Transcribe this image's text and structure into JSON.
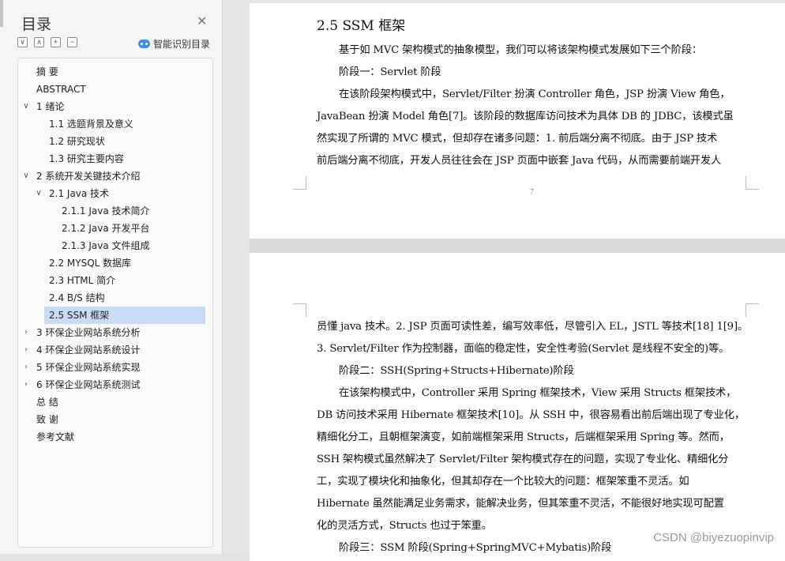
{
  "nav": {
    "title": "目录",
    "close_icon": "close-icon",
    "tools": [
      "collapse-all-icon",
      "collapse-level-icon",
      "expand-icon",
      "collapse-icon"
    ],
    "smart_toc_label": "智能识别目录",
    "items": [
      {
        "label": "摘    要",
        "level": 0,
        "caret": ""
      },
      {
        "label": "ABSTRACT",
        "level": 0,
        "caret": ""
      },
      {
        "label": "1 绪论",
        "level": 0,
        "caret": "∨"
      },
      {
        "label": "1.1 选题背景及意义",
        "level": 1,
        "caret": ""
      },
      {
        "label": "1.2 研究现状",
        "level": 1,
        "caret": ""
      },
      {
        "label": "1.3 研究主要内容",
        "level": 1,
        "caret": ""
      },
      {
        "label": "2 系统开发关键技术介绍",
        "level": 0,
        "caret": "∨"
      },
      {
        "label": "2.1 Java 技术",
        "level": 1,
        "caret": "∨"
      },
      {
        "label": "2.1.1 Java 技术简介",
        "level": 2,
        "caret": ""
      },
      {
        "label": "2.1.2 Java 开发平台",
        "level": 2,
        "caret": ""
      },
      {
        "label": "2.1.3 Java 文件组成",
        "level": 2,
        "caret": ""
      },
      {
        "label": "2.2 MYSQL 数据库",
        "level": 1,
        "caret": ""
      },
      {
        "label": "2.3 HTML 简介",
        "level": 1,
        "caret": ""
      },
      {
        "label": "2.4 B/S 结构",
        "level": 1,
        "caret": ""
      },
      {
        "label": "2.5 SSM 框架",
        "level": 1,
        "caret": "",
        "selected": true
      },
      {
        "label": "3 环保企业网站系统分析",
        "level": 0,
        "caret": "›"
      },
      {
        "label": "4 环保企业网站系统设计",
        "level": 0,
        "caret": "›"
      },
      {
        "label": "5 环保企业网站系统实现",
        "level": 0,
        "caret": "›"
      },
      {
        "label": "6 环保企业网站系统测试",
        "level": 0,
        "caret": "›"
      },
      {
        "label": "总    结",
        "level": 0,
        "caret": ""
      },
      {
        "label": "致    谢",
        "level": 0,
        "caret": ""
      },
      {
        "label": "参考文献",
        "level": 0,
        "caret": ""
      }
    ]
  },
  "doc": {
    "page1": {
      "heading": "2.5 SSM 框架",
      "lines": [
        {
          "text": "基于如 MVC 架构模式的抽象模型，我们可以将该架构模式发展如下三个阶段：",
          "indent": true
        },
        {
          "text": "阶段一：Servlet 阶段",
          "indent": true
        },
        {
          "text": "在该阶段架构模式中，Servlet/Filter 扮演 Controller 角色，JSP 扮演 View 角色，",
          "indent": true
        },
        {
          "text": "JavaBean 扮演 Model 角色[7]。该阶段的数据库访问技术为具体 DB 的 JDBC，该模式虽",
          "indent": false
        },
        {
          "text": "然实现了所谓的 MVC 模式，但却存在诸多问题：1. 前后端分离不彻底。由于 JSP 技术",
          "indent": false
        },
        {
          "text": "前后端分离不彻底，开发人员往往会在 JSP 页面中嵌套 Java 代码，从而需要前端开发人",
          "indent": false
        }
      ],
      "page_number": "7"
    },
    "page2": {
      "lines": [
        {
          "text": "员懂 java 技术。2. JSP 页面可读性差，编写效率低，尽管引入 EL，JSTL 等技术[18] 1[9]。",
          "indent": false
        },
        {
          "text": "3. Servlet/Filter 作为控制器，面临的稳定性，安全性考验(Servlet 是线程不安全的)等。",
          "indent": false
        },
        {
          "text": "阶段二：SSH(Spring+Structs+Hibernate)阶段",
          "indent": true
        },
        {
          "text": "在该架构模式中，Controller 采用 Spring 框架技术，View 采用 Structs 框架技术，",
          "indent": true
        },
        {
          "text": "DB 访问技术采用 Hibernate 框架技术[10]。从 SSH 中，很容易看出前后端出现了专业化，",
          "indent": false
        },
        {
          "text": "精细化分工，且朝框架演变，如前端框架采用 Structs，后端框架采用 Spring 等。然而，",
          "indent": false
        },
        {
          "text": "SSH 架构模式虽然解决了 Servlet/Filter 架构模式存在的问题，实现了专业化、精细化分",
          "indent": false
        },
        {
          "text": "工，实现了模块化和抽象化，但其却存在一个比较大的问题：框架笨重不灵活。如",
          "indent": false
        },
        {
          "text": "Hibernate 虽然能满足业务需求，能解决业务，但其笨重不灵活，不能很好地实现可配置",
          "indent": false
        },
        {
          "text": "化的灵活方式，Structs 也过于笨重。",
          "indent": false
        },
        {
          "text": "阶段三：SSM 阶段(Spring+SpringMVC+Mybatis)阶段",
          "indent": true
        }
      ]
    },
    "watermark": "CSDN @biyezuopinvip"
  }
}
